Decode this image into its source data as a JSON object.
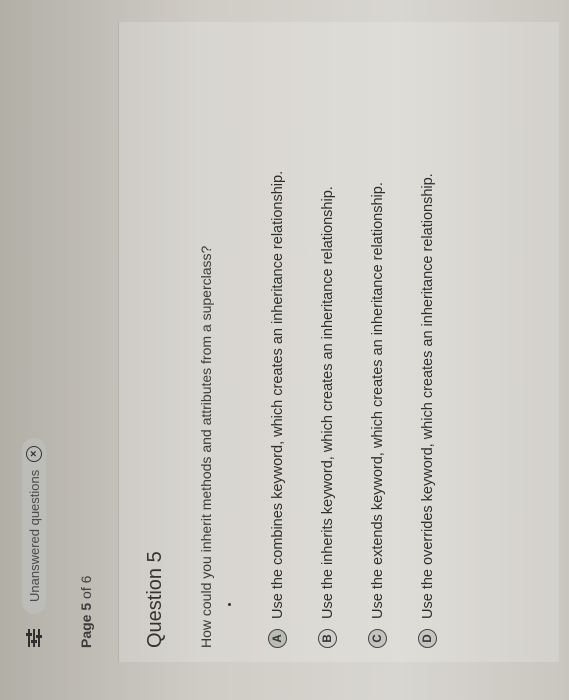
{
  "filter": {
    "icon": "filter-sliders-icon",
    "chip_label": "Unanswered questions",
    "chip_close_glyph": "×"
  },
  "pagination": {
    "prefix": "Page",
    "current": "5",
    "separator": "of",
    "total": "6"
  },
  "question": {
    "title": "Question 5",
    "text": "How could you inherit methods and attributes from a superclass?",
    "options": [
      {
        "letter": "A",
        "text": "Use the combines keyword, which creates an inheritance relationship."
      },
      {
        "letter": "B",
        "text": "Use the inherits keyword, which creates an inheritance relationship."
      },
      {
        "letter": "C",
        "text": "Use the extends keyword, which creates an inheritance relationship."
      },
      {
        "letter": "D",
        "text": "Use the overrides keyword, which creates an inheritance relationship."
      }
    ]
  }
}
